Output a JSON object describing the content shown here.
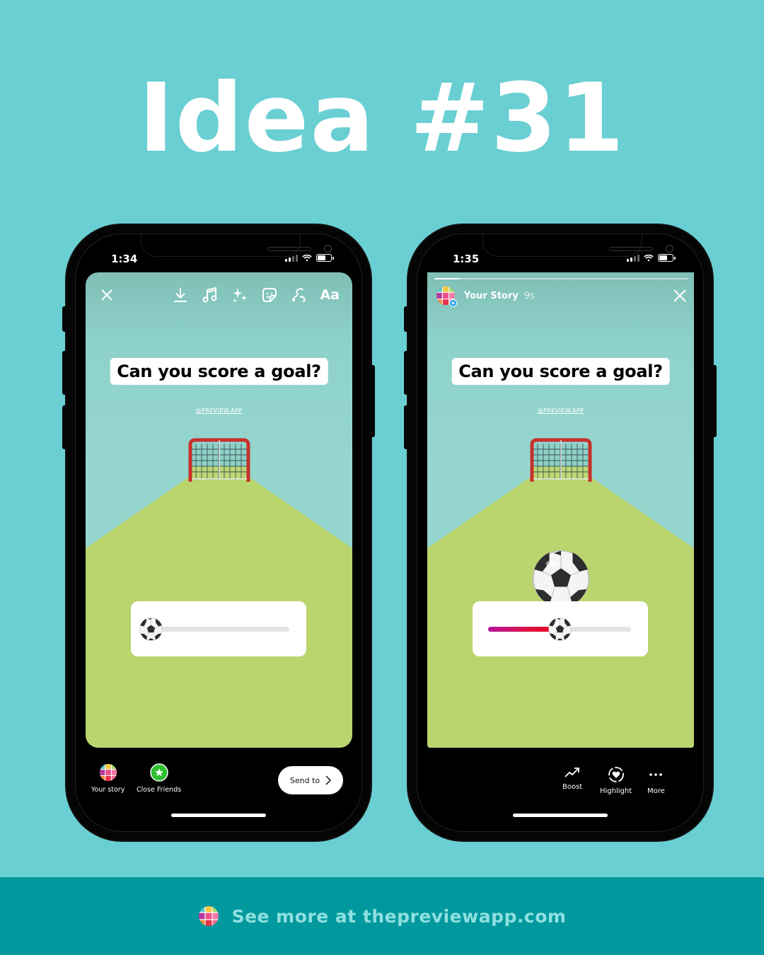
{
  "headline": "Idea #31",
  "colors": {
    "background": "#6acfd3",
    "footer_bg": "#01999e",
    "footer_text": "#8fe0e0",
    "slider_gradient_start": "#b4159a",
    "slider_gradient_end": "#f3001c",
    "close_friends_green": "#2fbf2f"
  },
  "left_phone": {
    "status": {
      "time": "1:34"
    },
    "toolbar": {
      "icons": [
        "close-icon",
        "download-icon",
        "music-icon",
        "effects-icon",
        "sticker-icon",
        "draw-icon",
        "text-icon"
      ],
      "text_tool_label": "Aa"
    },
    "story": {
      "question": "Can you score a goal?",
      "watermark": "@PREVIEW.APP",
      "slider_emoji": "⚽",
      "slider_value": 0
    },
    "bottom": {
      "your_story_label": "Your story",
      "close_friends_label": "Close Friends",
      "send_to_label": "Send to"
    }
  },
  "right_phone": {
    "status": {
      "time": "1:35"
    },
    "header": {
      "account_name": "Your Story",
      "age": "9s",
      "progress": 0.1
    },
    "story": {
      "question": "Can you score a goal?",
      "watermark": "@PREVIEW.APP",
      "slider_emoji": "⚽",
      "slider_value": 0.5
    },
    "bottom": {
      "actions": [
        {
          "icon": "boost-icon",
          "label": "Boost"
        },
        {
          "icon": "highlight-icon",
          "label": "Highlight"
        },
        {
          "icon": "more-icon",
          "label": "More"
        }
      ]
    }
  },
  "footer": {
    "text": "See more at thepreviewapp.com"
  }
}
